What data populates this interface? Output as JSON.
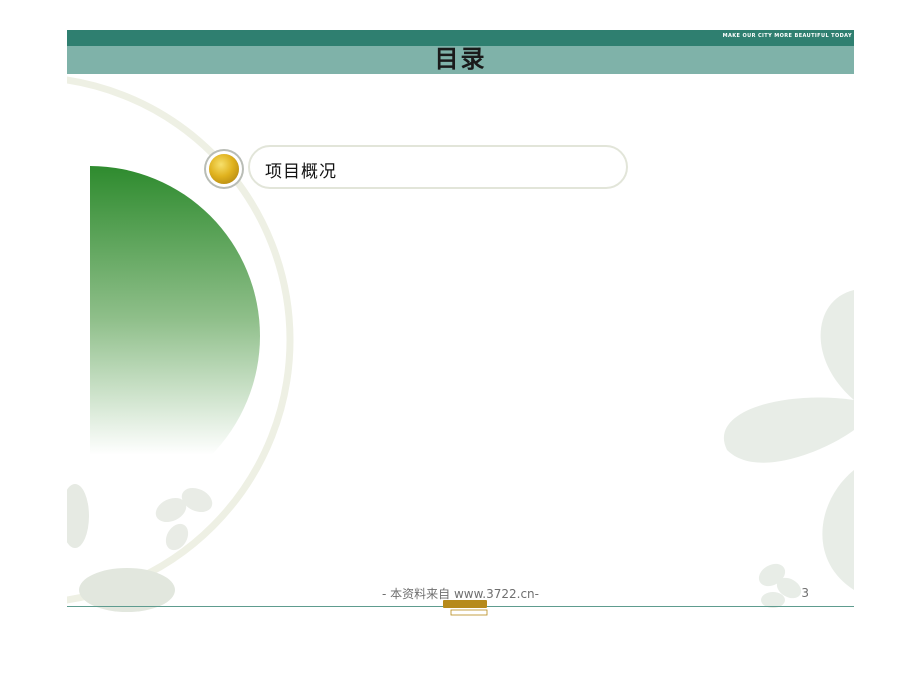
{
  "header": {
    "title": "目录",
    "tagline": "MAKE OUR CITY MORE BEAUTIFUL TODAY"
  },
  "toc": {
    "items": [
      {
        "label": "项目概况"
      }
    ]
  },
  "footer": {
    "source_text": "- 本资料来自 www.3722.cn-",
    "page_number": "3"
  },
  "colors": {
    "header_dark": "#2f7f70",
    "header_light": "#7fb2a9",
    "accent_green": "#2e8b2e",
    "bullet_gold": "#e0b21e"
  }
}
